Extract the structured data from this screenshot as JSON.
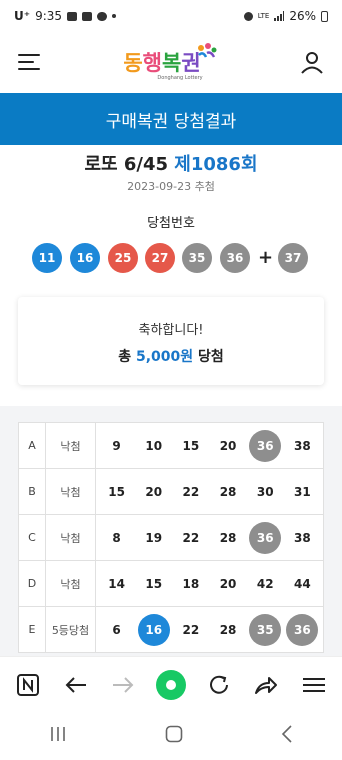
{
  "status": {
    "carrier": "U⁺",
    "time": "9:35",
    "network": "LTE",
    "battery": "26%"
  },
  "header": {
    "logo_text": [
      "동",
      "행",
      "복",
      "권"
    ],
    "logo_sub": "Donghang Lottery"
  },
  "title_bar": "구매복권 당첨결과",
  "draw": {
    "game": "로또 6/45",
    "round": "제1086회",
    "date": "2023-09-23 추첨",
    "win_label": "당첨번호",
    "numbers": [
      {
        "n": "11",
        "color": "#1e88d9"
      },
      {
        "n": "16",
        "color": "#1e88d9"
      },
      {
        "n": "25",
        "color": "#e5584a"
      },
      {
        "n": "27",
        "color": "#e5584a"
      },
      {
        "n": "35",
        "color": "#8e8e8e"
      },
      {
        "n": "36",
        "color": "#8e8e8e"
      }
    ],
    "plus": "+",
    "bonus": {
      "n": "37",
      "color": "#8e8e8e"
    }
  },
  "prize": {
    "congrats": "축하합니다!",
    "prefix": "총",
    "amount": "5,000원",
    "suffix": "당첨"
  },
  "tickets": [
    {
      "slot": "A",
      "result": "낙첨",
      "numbers": [
        {
          "n": "9"
        },
        {
          "n": "10"
        },
        {
          "n": "15"
        },
        {
          "n": "20"
        },
        {
          "n": "36",
          "hl": "#8e8e8e"
        },
        {
          "n": "38"
        }
      ]
    },
    {
      "slot": "B",
      "result": "낙첨",
      "numbers": [
        {
          "n": "15"
        },
        {
          "n": "20"
        },
        {
          "n": "22"
        },
        {
          "n": "28"
        },
        {
          "n": "30"
        },
        {
          "n": "31"
        }
      ]
    },
    {
      "slot": "C",
      "result": "낙첨",
      "numbers": [
        {
          "n": "8"
        },
        {
          "n": "19"
        },
        {
          "n": "22"
        },
        {
          "n": "28"
        },
        {
          "n": "36",
          "hl": "#8e8e8e"
        },
        {
          "n": "38"
        }
      ]
    },
    {
      "slot": "D",
      "result": "낙첨",
      "numbers": [
        {
          "n": "14"
        },
        {
          "n": "15"
        },
        {
          "n": "18"
        },
        {
          "n": "20"
        },
        {
          "n": "42"
        },
        {
          "n": "44"
        }
      ]
    },
    {
      "slot": "E",
      "result": "5등당첨",
      "numbers": [
        {
          "n": "6"
        },
        {
          "n": "16",
          "hl": "#1e88d9"
        },
        {
          "n": "22"
        },
        {
          "n": "28"
        },
        {
          "n": "35",
          "hl": "#8e8e8e"
        },
        {
          "n": "36",
          "hl": "#8e8e8e"
        }
      ]
    }
  ],
  "colors": {
    "brand_blue": "#0a7bc4",
    "accent_green": "#17c964"
  },
  "browser_toolbar": [
    "n-icon",
    "back-arrow-icon",
    "forward-arrow-icon",
    "home-circle-icon",
    "refresh-icon",
    "share-icon",
    "menu-lines-icon"
  ],
  "system_nav": [
    "recent-apps-icon",
    "home-icon",
    "back-icon"
  ]
}
